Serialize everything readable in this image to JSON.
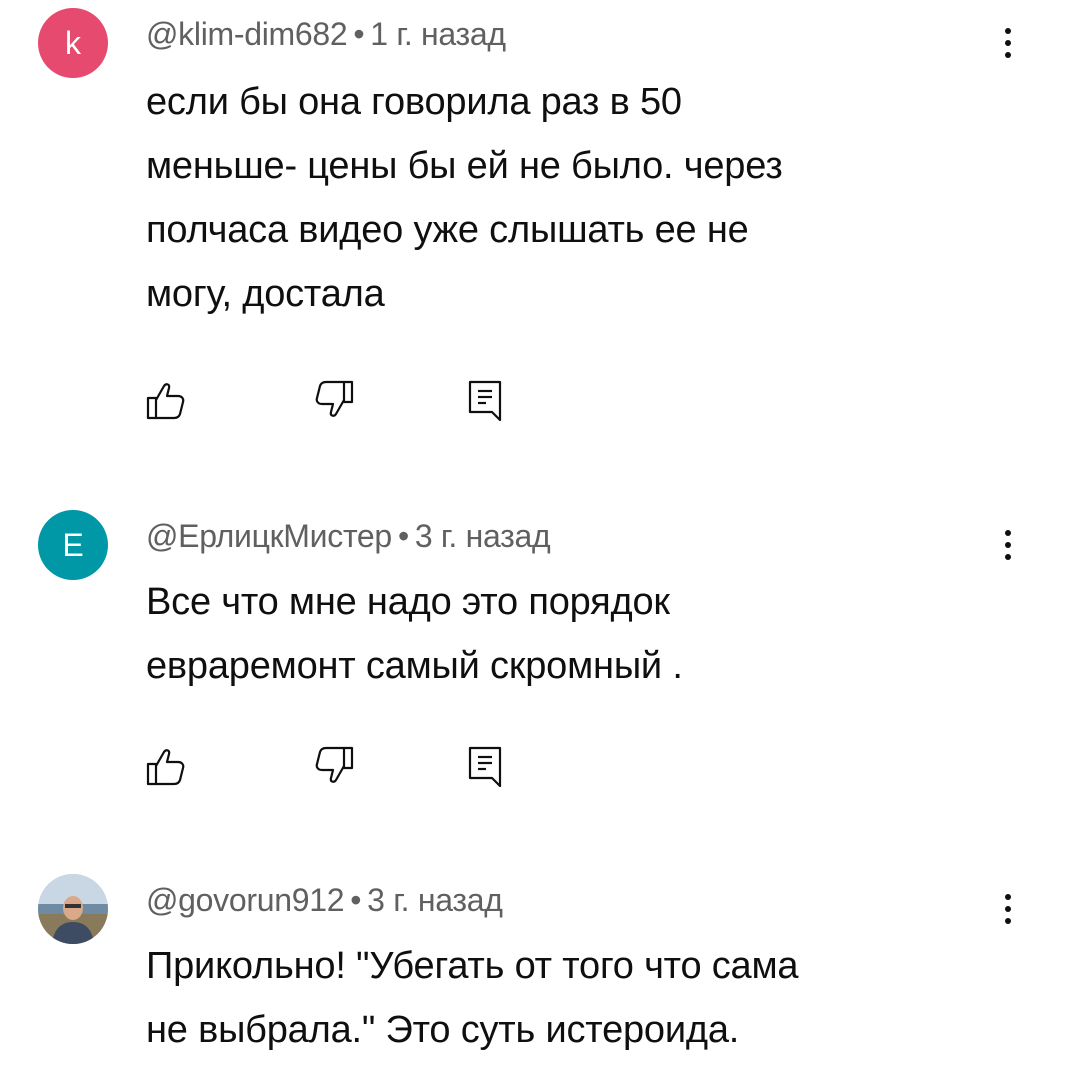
{
  "comments": [
    {
      "avatar": {
        "kind": "letter",
        "letter": "k",
        "color": "#e64a6e"
      },
      "author": "@klim-dim682",
      "separator": "•",
      "time": "1 г. назад",
      "lines": [
        "если бы она говорила раз в 50",
        "меньше- цены бы ей не было. через",
        "полчаса видео уже слышать ее не",
        "могу, достала"
      ],
      "actions": [
        "like-icon",
        "dislike-icon",
        "reply-icon"
      ],
      "menu_icon": "more-vert-icon"
    },
    {
      "avatar": {
        "kind": "letter",
        "letter": "E",
        "color": "#0097a7"
      },
      "author": "@ЕрлицкМистер",
      "separator": "•",
      "time": "3 г. назад",
      "lines": [
        "Все что мне надо это порядок",
        "евраремонт самый скромный ."
      ],
      "actions": [
        "like-icon",
        "dislike-icon",
        "reply-icon"
      ],
      "menu_icon": "more-vert-icon"
    },
    {
      "avatar": {
        "kind": "photo"
      },
      "author": "@govorun912",
      "separator": "•",
      "time": "3 г. назад",
      "lines": [
        "Прикольно! \"Убегать от того что сама",
        "не выбрала.\" Это суть истероида."
      ],
      "menu_icon": "more-vert-icon"
    }
  ]
}
